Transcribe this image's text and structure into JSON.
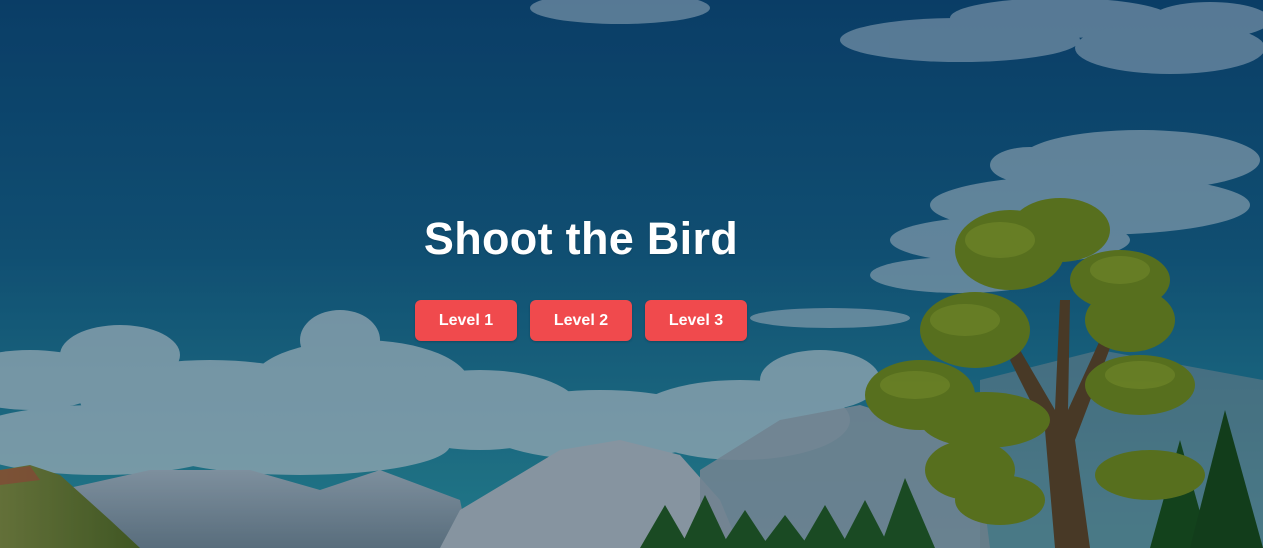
{
  "title": "Shoot the Bird",
  "levels": [
    {
      "label": "Level 1"
    },
    {
      "label": "Level 2"
    },
    {
      "label": "Level 3"
    }
  ],
  "colors": {
    "button": "#f04a4d",
    "title": "#ffffff",
    "sky_top": "#0b4a78",
    "sky_bottom": "#1f8fa6"
  }
}
